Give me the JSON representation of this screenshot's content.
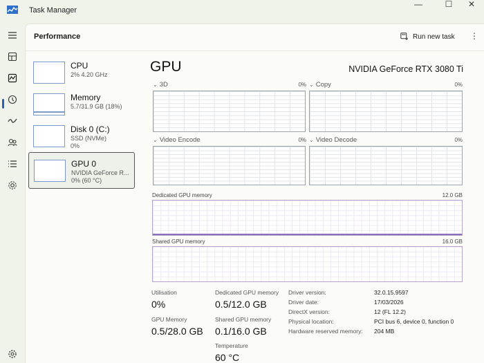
{
  "window": {
    "title": "Task Manager",
    "minimize": "—",
    "maximize": "☐",
    "close": "✕"
  },
  "header": {
    "title": "Performance",
    "run_new_task": "Run new task",
    "more": "⋮"
  },
  "devices": [
    {
      "name": "CPU",
      "sub1": "2% 4.20 GHz",
      "sub2": ""
    },
    {
      "name": "Memory",
      "sub1": "5.7/31.9 GB (18%)",
      "sub2": ""
    },
    {
      "name": "Disk 0 (C:)",
      "sub1": "SSD (NVMe)",
      "sub2": "0%"
    },
    {
      "name": "GPU 0",
      "sub1": "NVIDIA GeForce R...",
      "sub2": "0% (60 °C)"
    }
  ],
  "detail": {
    "title": "GPU",
    "model": "NVIDIA GeForce RTX 3080 Ti",
    "engines": [
      {
        "label": "3D",
        "pct": "0%"
      },
      {
        "label": "Copy",
        "pct": "0%"
      },
      {
        "label": "Video Encode",
        "pct": "0%"
      },
      {
        "label": "Video Decode",
        "pct": "0%"
      }
    ],
    "dedicated": {
      "label": "Dedicated GPU memory",
      "max": "12.0 GB"
    },
    "shared": {
      "label": "Shared GPU memory",
      "max": "16.0 GB"
    }
  },
  "stats": {
    "utilisation_label": "Utilisation",
    "utilisation_value": "0%",
    "gpu_memory_label": "GPU Memory",
    "gpu_memory_value": "0.5/28.0 GB",
    "dedicated_label": "Dedicated GPU memory",
    "dedicated_value": "0.5/12.0 GB",
    "shared_label": "Shared GPU memory",
    "shared_value": "0.1/16.0 GB",
    "temperature_label": "Temperature",
    "temperature_value": "60 °C"
  },
  "info": [
    {
      "key": "Driver version:",
      "value": "32.0.15.9597"
    },
    {
      "key": "Driver date:",
      "value": "17/03/2026"
    },
    {
      "key": "DirectX version:",
      "value": "12 (FL 12.2)"
    },
    {
      "key": "Physical location:",
      "value": "PCI bus 6, device 0, function 0"
    },
    {
      "key": "Hardware reserved memory:",
      "value": "204 MB"
    }
  ],
  "nav": [
    "hamburger-icon",
    "processes-icon",
    "performance-icon",
    "app-history-icon",
    "startup-apps-icon",
    "users-icon",
    "details-icon",
    "services-icon",
    "settings-icon"
  ],
  "colors": {
    "accent": "#2a5fb8",
    "gpu_graph": "#7b9ac9",
    "memory_graph": "#8a6fc0"
  }
}
